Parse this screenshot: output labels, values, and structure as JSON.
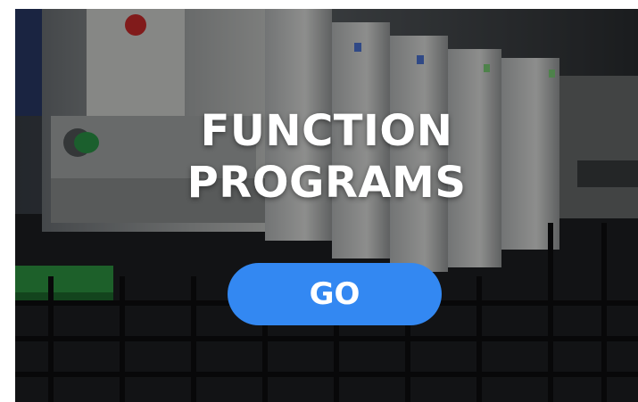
{
  "banner": {
    "title_line1": "FUNCTION",
    "title_line2": "PROGRAMS",
    "background_image": "controller-modules-photo",
    "overlay_color": "#000000"
  },
  "cta": {
    "label": "GO",
    "color": "#3388f2",
    "text_color": "#ffffff"
  }
}
